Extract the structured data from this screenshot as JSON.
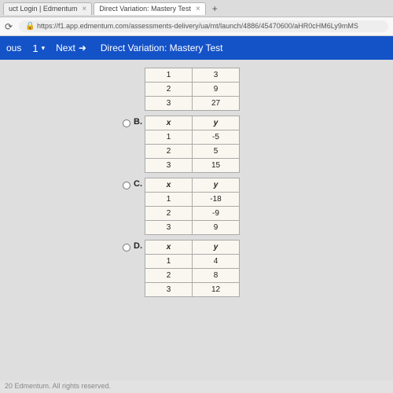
{
  "tabs": {
    "t1": "uct Login | Edmentum",
    "t2": "Direct Variation: Mastery Test"
  },
  "addr": {
    "refresh_glyph": "⟳",
    "lock_glyph": "🔒",
    "url": "https://f1.app.edmentum.com/assessments-delivery/ua/mt/launch/4886/45470600/aHR0cHM6Ly9mMS"
  },
  "nav": {
    "prev": "ous",
    "num": "1",
    "chev": "▾",
    "next": "Next",
    "next_icon": "➜",
    "title": "Direct Variation: Mastery Test"
  },
  "options": {
    "a": {
      "label": "",
      "rows": [
        [
          "1",
          "3"
        ],
        [
          "2",
          "9"
        ],
        [
          "3",
          "27"
        ]
      ]
    },
    "b": {
      "label": "B.",
      "head": [
        "x",
        "y"
      ],
      "rows": [
        [
          "1",
          "-5"
        ],
        [
          "2",
          "5"
        ],
        [
          "3",
          "15"
        ]
      ]
    },
    "c": {
      "label": "C.",
      "head": [
        "x",
        "y"
      ],
      "rows": [
        [
          "1",
          "-18"
        ],
        [
          "2",
          "-9"
        ],
        [
          "3",
          "9"
        ]
      ]
    },
    "d": {
      "label": "D.",
      "head": [
        "x",
        "y"
      ],
      "rows": [
        [
          "1",
          "4"
        ],
        [
          "2",
          "8"
        ],
        [
          "3",
          "12"
        ]
      ]
    }
  },
  "footer": "20 Edmentum. All rights reserved.",
  "chart_data": [
    {
      "type": "table",
      "title": "Option A",
      "series": [
        {
          "name": "x",
          "values": [
            1,
            2,
            3
          ]
        },
        {
          "name": "y",
          "values": [
            3,
            9,
            27
          ]
        }
      ]
    },
    {
      "type": "table",
      "title": "Option B",
      "series": [
        {
          "name": "x",
          "values": [
            1,
            2,
            3
          ]
        },
        {
          "name": "y",
          "values": [
            -5,
            5,
            15
          ]
        }
      ]
    },
    {
      "type": "table",
      "title": "Option C",
      "series": [
        {
          "name": "x",
          "values": [
            1,
            2,
            3
          ]
        },
        {
          "name": "y",
          "values": [
            -18,
            -9,
            9
          ]
        }
      ]
    },
    {
      "type": "table",
      "title": "Option D",
      "series": [
        {
          "name": "x",
          "values": [
            1,
            2,
            3
          ]
        },
        {
          "name": "y",
          "values": [
            4,
            8,
            12
          ]
        }
      ]
    }
  ]
}
